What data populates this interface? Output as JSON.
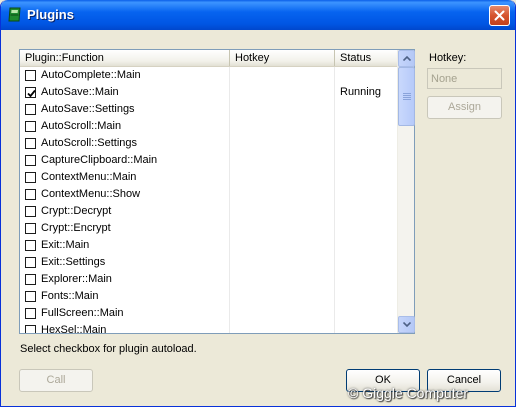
{
  "window": {
    "title": "Plugins"
  },
  "list": {
    "columns": [
      "Plugin::Function",
      "Hotkey",
      "Status"
    ],
    "rows": [
      {
        "name": "AutoComplete::Main",
        "hotkey": "",
        "status": "",
        "checked": false
      },
      {
        "name": "AutoSave::Main",
        "hotkey": "",
        "status": "Running",
        "checked": true
      },
      {
        "name": "AutoSave::Settings",
        "hotkey": "",
        "status": "",
        "checked": false
      },
      {
        "name": "AutoScroll::Main",
        "hotkey": "",
        "status": "",
        "checked": false
      },
      {
        "name": "AutoScroll::Settings",
        "hotkey": "",
        "status": "",
        "checked": false
      },
      {
        "name": "CaptureClipboard::Main",
        "hotkey": "",
        "status": "",
        "checked": false
      },
      {
        "name": "ContextMenu::Main",
        "hotkey": "",
        "status": "",
        "checked": false
      },
      {
        "name": "ContextMenu::Show",
        "hotkey": "",
        "status": "",
        "checked": false
      },
      {
        "name": "Crypt::Decrypt",
        "hotkey": "",
        "status": "",
        "checked": false
      },
      {
        "name": "Crypt::Encrypt",
        "hotkey": "",
        "status": "",
        "checked": false
      },
      {
        "name": "Exit::Main",
        "hotkey": "",
        "status": "",
        "checked": false
      },
      {
        "name": "Exit::Settings",
        "hotkey": "",
        "status": "",
        "checked": false
      },
      {
        "name": "Explorer::Main",
        "hotkey": "",
        "status": "",
        "checked": false
      },
      {
        "name": "Fonts::Main",
        "hotkey": "",
        "status": "",
        "checked": false
      },
      {
        "name": "FullScreen::Main",
        "hotkey": "",
        "status": "",
        "checked": false
      },
      {
        "name": "HexSel::Main",
        "hotkey": "",
        "status": "",
        "checked": false
      }
    ]
  },
  "hint": "Select checkbox for plugin autoload.",
  "hotkey": {
    "label": "Hotkey:",
    "value": "None",
    "assign_label": "Assign"
  },
  "buttons": {
    "call": "Call",
    "ok": "OK",
    "cancel": "Cancel"
  },
  "watermark": "© Giggle Computer",
  "colors": {
    "titlebar": "#0055e3",
    "window_bg": "#ece9d8",
    "list_border": "#7f9db9"
  }
}
